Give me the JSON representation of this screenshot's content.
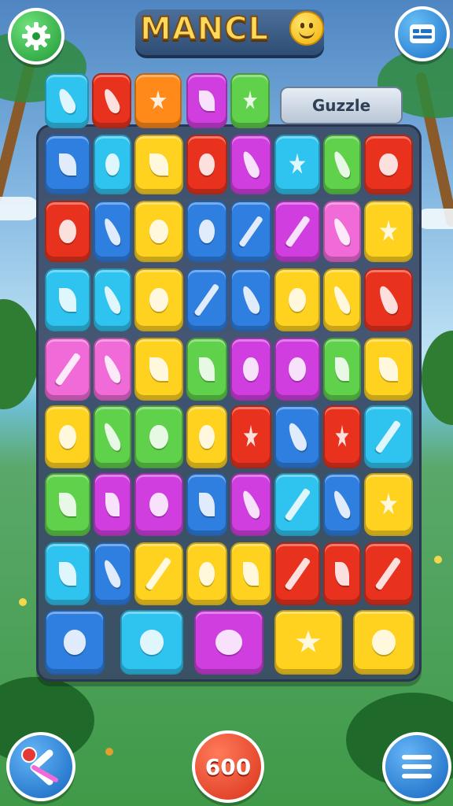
{
  "header": {
    "title": "MANCL",
    "puzzle_label": "Guzzle"
  },
  "footer": {
    "score": "600"
  },
  "icons": {
    "settings": "gear-icon",
    "ticket": "ticket-icon",
    "back": "back-arrow-icon",
    "menu": "hamburger-menu-icon",
    "title_emoji": "smiley-face-icon"
  },
  "colors": {
    "board_bg": "#3a4a66",
    "tile_colors": {
      "green": "#5fd14a",
      "red": "#e8321e",
      "orange": "#ff8a1a",
      "yellow": "#ffd21f",
      "blue": "#2f7fe0",
      "cyan": "#2fc4f0",
      "magenta": "#d03ee0",
      "pink": "#f06ad8"
    }
  },
  "board": {
    "rows": [
      [
        [
          "cyan",
          "bean"
        ],
        [
          "red",
          "bean"
        ],
        [
          "orange",
          "star"
        ],
        [
          "magenta",
          "leaf"
        ],
        [
          "green",
          "star"
        ]
      ],
      [
        [
          "blue",
          "leaf"
        ],
        [
          "cyan",
          "dot"
        ],
        [
          "yellow",
          "leaf"
        ],
        [
          "red",
          "dot"
        ],
        [
          "magenta",
          "bean"
        ],
        [
          "cyan",
          "star"
        ],
        [
          "green",
          "bean"
        ],
        [
          "red",
          "dot"
        ]
      ],
      [
        [
          "red",
          "dot"
        ],
        [
          "blue",
          "bean"
        ],
        [
          "yellow",
          "dot"
        ],
        [
          "blue",
          "dot"
        ],
        [
          "blue",
          "pencil"
        ],
        [
          "magenta",
          "pencil"
        ],
        [
          "pink",
          "bean"
        ],
        [
          "yellow",
          "star"
        ]
      ],
      [
        [
          "cyan",
          "leaf"
        ],
        [
          "cyan",
          "bean"
        ],
        [
          "yellow",
          "dot"
        ],
        [
          "blue",
          "pencil"
        ],
        [
          "blue",
          "bean"
        ],
        [
          "yellow",
          "dot"
        ],
        [
          "yellow",
          "bean"
        ],
        [
          "red",
          "bean"
        ]
      ],
      [
        [
          "pink",
          "pencil"
        ],
        [
          "pink",
          "bean"
        ],
        [
          "yellow",
          "leaf"
        ],
        [
          "green",
          "leaf"
        ],
        [
          "magenta",
          "dot"
        ],
        [
          "magenta",
          "dot"
        ],
        [
          "green",
          "leaf"
        ],
        [
          "yellow",
          "leaf"
        ]
      ],
      [
        [
          "yellow",
          "dot"
        ],
        [
          "green",
          "bean"
        ],
        [
          "green",
          "dot"
        ],
        [
          "yellow",
          "dot"
        ],
        [
          "red",
          "star"
        ],
        [
          "blue",
          "bean"
        ],
        [
          "red",
          "star"
        ],
        [
          "cyan",
          "pencil"
        ]
      ],
      [
        [
          "green",
          "leaf"
        ],
        [
          "magenta",
          "leaf"
        ],
        [
          "magenta",
          "dot"
        ],
        [
          "blue",
          "leaf"
        ],
        [
          "magenta",
          "bean"
        ],
        [
          "cyan",
          "pencil"
        ],
        [
          "blue",
          "bean"
        ],
        [
          "yellow",
          "star"
        ]
      ],
      [
        [
          "cyan",
          "leaf"
        ],
        [
          "blue",
          "bean"
        ],
        [
          "yellow",
          "pencil"
        ],
        [
          "yellow",
          "dot"
        ],
        [
          "yellow",
          "leaf"
        ],
        [
          "red",
          "pencil"
        ],
        [
          "red",
          "leaf"
        ],
        [
          "red",
          "pencil"
        ]
      ],
      [
        [
          "blue",
          "dot"
        ],
        [
          "cyan",
          "dot"
        ],
        [
          "magenta",
          "dot"
        ],
        [
          "yellow",
          "star"
        ],
        [
          "yellow",
          "dot"
        ]
      ]
    ]
  }
}
